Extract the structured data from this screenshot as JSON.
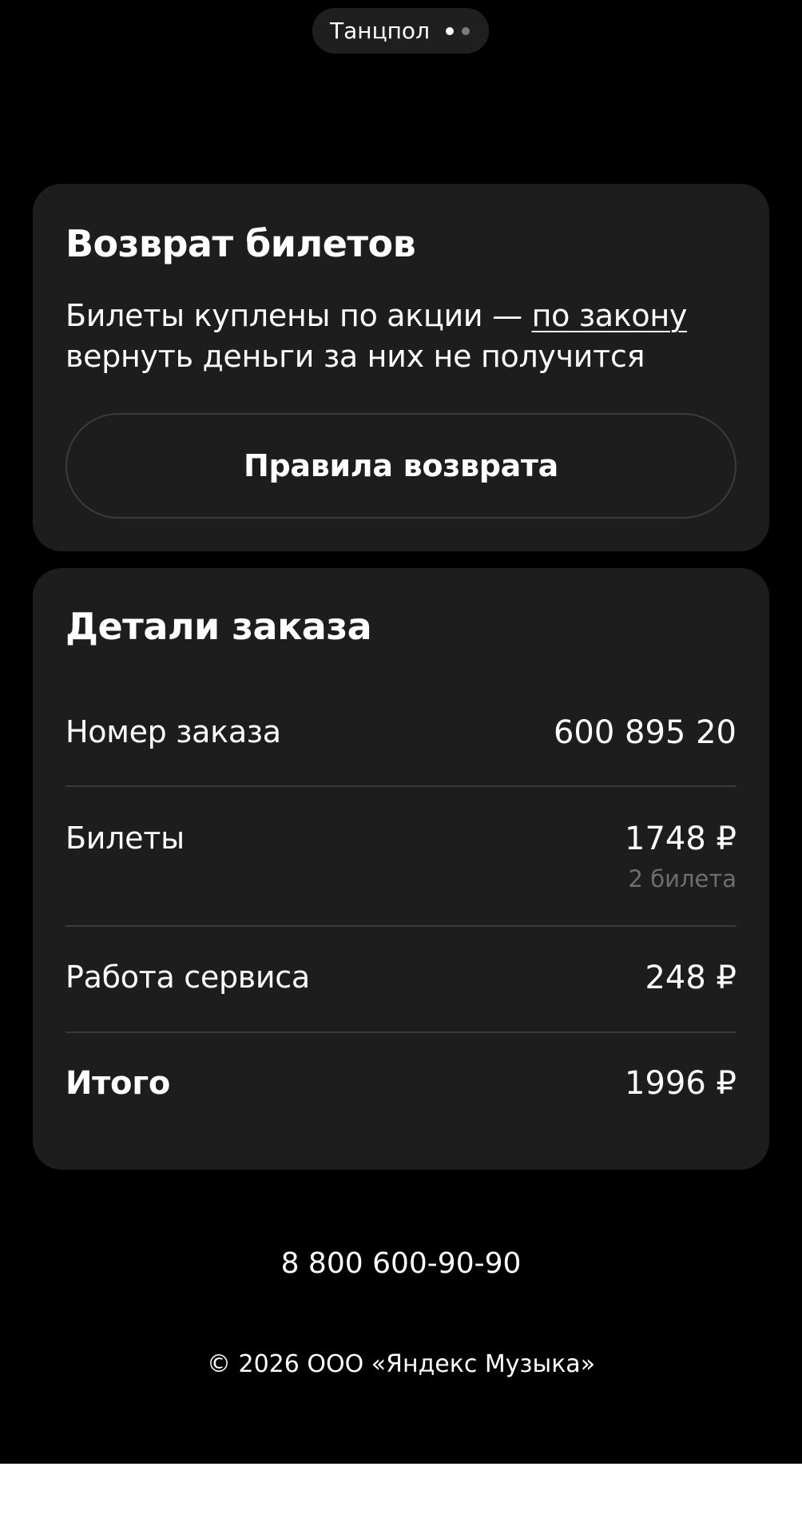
{
  "header": {
    "zone_label": "Танцпол",
    "pager": {
      "count": 2,
      "active_index": 0
    }
  },
  "refund_card": {
    "title": "Возврат билетов",
    "text_before_link": "Билеты куплены по акции — ",
    "link_text": "по закону",
    "text_after_link": " вернуть деньги за них не получится",
    "rules_button_label": "Правила возврата"
  },
  "order_card": {
    "title": "Детали заказа",
    "rows": {
      "order_number": {
        "label": "Номер заказа",
        "value": "600 895 20"
      },
      "tickets": {
        "label": "Билеты",
        "value": "1748 ₽",
        "sub": "2 билета"
      },
      "service": {
        "label": "Работа сервиса",
        "value": "248 ₽"
      },
      "total": {
        "label": "Итого",
        "value": "1996 ₽"
      }
    }
  },
  "footer": {
    "phone": "8 800 600-90-90",
    "copyright": "© 2026 ООО «Яндекс Музыка»"
  }
}
